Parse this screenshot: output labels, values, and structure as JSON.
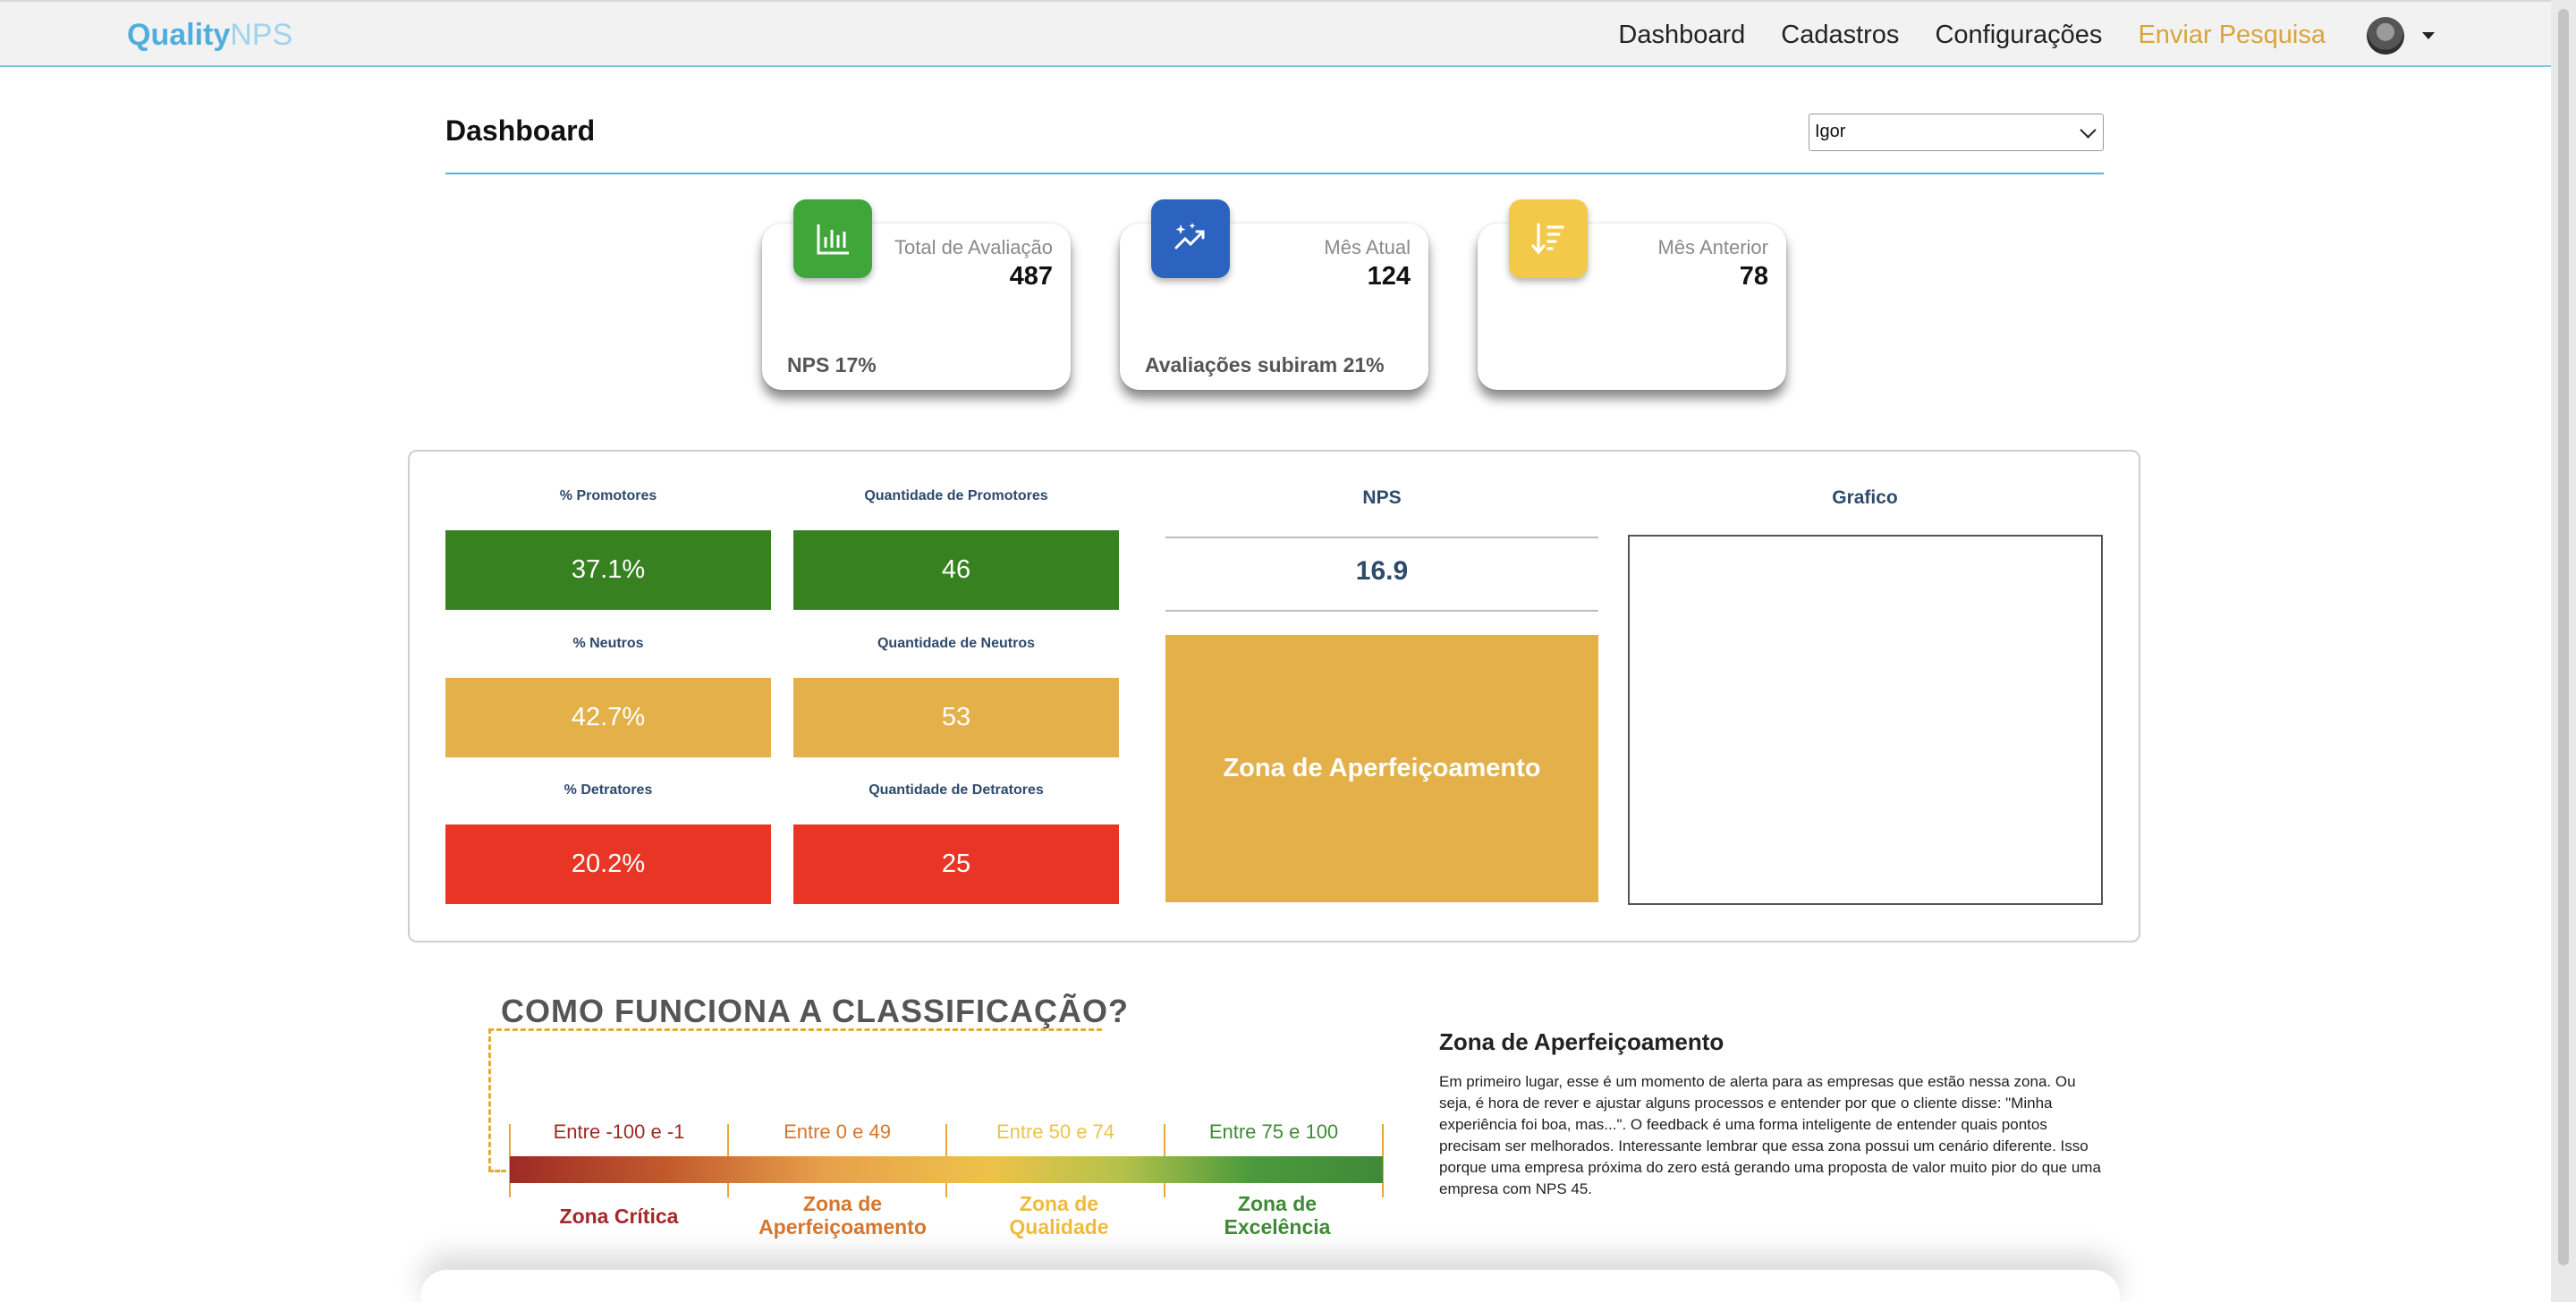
{
  "navbar": {
    "brand_part1": "Quality",
    "brand_part2": "NPS",
    "links": [
      "Dashboard",
      "Cadastros",
      "Configurações",
      "Enviar Pesquisa"
    ],
    "active_link": "Enviar Pesquisa",
    "accent_color": "#d9a53a"
  },
  "header": {
    "title": "Dashboard",
    "user_select_value": "Igor"
  },
  "cards": [
    {
      "icon": "bar-chart-icon",
      "label": "Total de Avaliação",
      "value": "487",
      "footer": "NPS 17%",
      "color": "#3fa63a"
    },
    {
      "icon": "sparkle-trend-icon",
      "label": "Mês Atual",
      "value": "124",
      "footer": "Avaliações subiram 21%",
      "color": "#2c63c0"
    },
    {
      "icon": "sort-down-icon",
      "label": "Mês Anterior",
      "value": "78",
      "footer": "",
      "color": "#f3c94a"
    }
  ],
  "metrics": {
    "promotores_pct_label": "% Promotores",
    "promotores_pct": "37.1%",
    "promotores_qty_label": "Quantidade de Promotores",
    "promotores_qty": "46",
    "neutros_pct_label": "% Neutros",
    "neutros_pct": "42.7%",
    "neutros_qty_label": "Quantidade de Neutros",
    "neutros_qty": "53",
    "detratores_pct_label": "% Detratores",
    "detratores_pct": "20.2%",
    "detratores_qty_label": "Quantidade de Detratores",
    "detratores_qty": "25",
    "colors": {
      "promotores": "#388121",
      "neutros": "#e3b049",
      "detratores": "#e93525"
    }
  },
  "nps": {
    "title": "NPS",
    "value": "16.9",
    "zone": "Zona de Aperfeiçoamento"
  },
  "grafico": {
    "title": "Grafico"
  },
  "classification": {
    "title": "COMO FUNCIONA A CLASSIFICAÇÃO?",
    "ranges": [
      "Entre -100 e -1",
      "Entre 0 e 49",
      "Entre 50 e 74",
      "Entre 75 e 100"
    ],
    "zones": [
      [
        "Zona Crítica"
      ],
      [
        "Zona de",
        "Aperfeiçoamento"
      ],
      [
        "Zona de",
        "Qualidade"
      ],
      [
        "Zona de",
        "Excelência"
      ]
    ],
    "range_colors": [
      "#9e2a25",
      "#d6762e",
      "#eec24a",
      "#3f8a37"
    ],
    "zone_colors": [
      "#a4272a",
      "#d6762e",
      "#eebb3c",
      "#3f8a37"
    ]
  },
  "info": {
    "title": "Zona de Aperfeiçoamento",
    "text": "Em primeiro lugar, esse é um momento de alerta para as empresas que estão nessa zona. Ou seja, é hora de rever e ajustar alguns processos e entender por que o cliente disse: \"Minha experiência foi boa, mas...\". O feedback é uma forma inteligente de entender quais pontos precisam ser melhorados. Interessante lembrar que essa zona possui um cenário diferente. Isso porque uma empresa próxima do zero está gerando uma proposta de valor muito pior do que uma empresa com NPS 45."
  }
}
